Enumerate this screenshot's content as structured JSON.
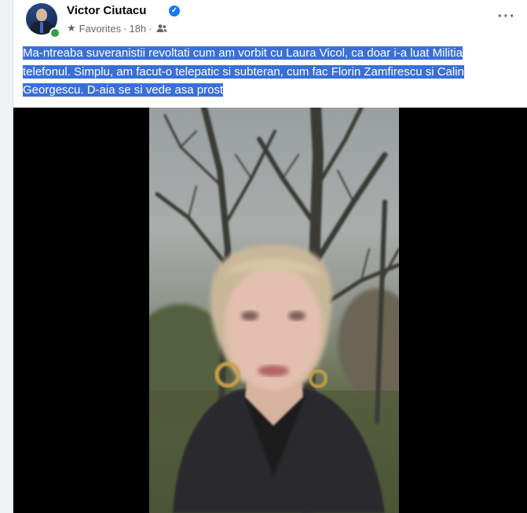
{
  "post": {
    "author": "Victor Ciutacu",
    "audience_label": "Favorites",
    "separator": "·",
    "timestamp": "18h",
    "text": "Ma-ntreaba suveranistii revoltati cum am vorbit cu Laura Vicol, ca doar i-a luat Militia telefonul. Simplu, am facut-o telepatic si subteran, cum fac Florin Zamfirescu si Calin Georgescu. D-aia se si vede asa prost"
  },
  "icons": {
    "verified": "verified-badge-icon",
    "audience": "star-icon",
    "privacy": "friends-icon",
    "more": "more-options-icon"
  },
  "colors": {
    "highlight": "#3a6fd8",
    "verified": "#1877f2",
    "online": "#31a24c"
  }
}
